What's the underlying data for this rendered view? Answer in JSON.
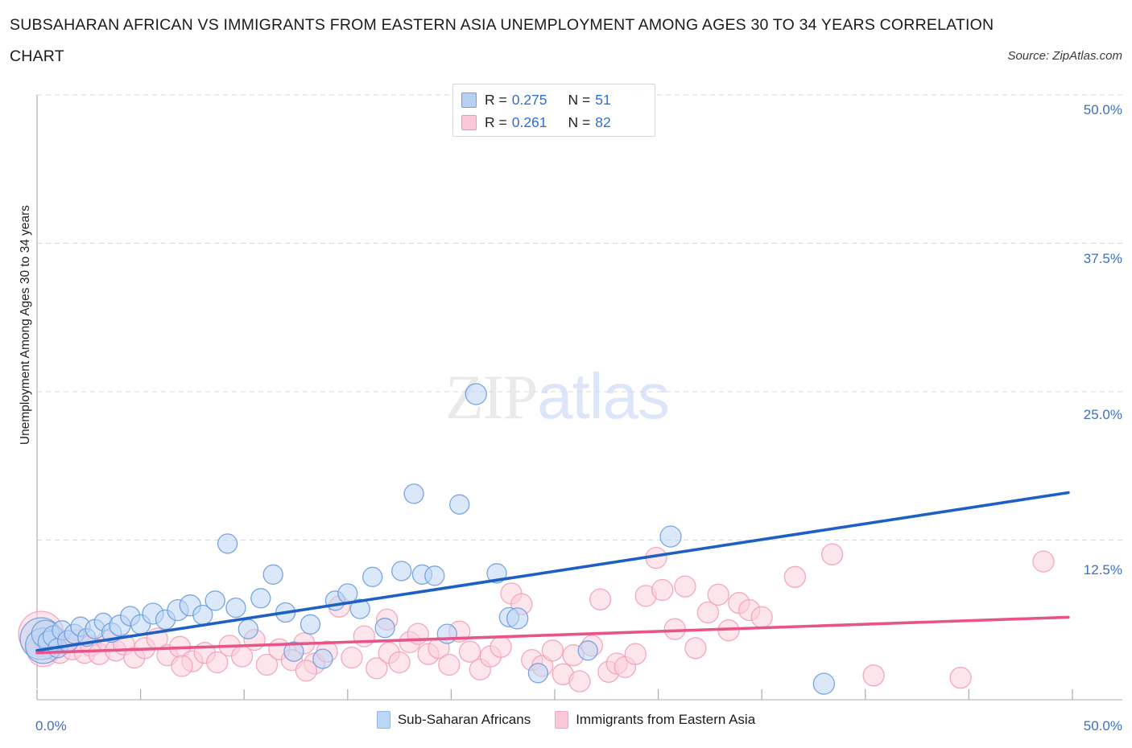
{
  "header": {
    "title_line1": "SUBSAHARAN AFRICAN VS IMMIGRANTS FROM EASTERN ASIA UNEMPLOYMENT AMONG AGES 30 TO 34 YEARS CORRELATION",
    "title_line2": "CHART",
    "source": "Source: ZipAtlas.com"
  },
  "watermark": {
    "part1": "ZIP",
    "part2": "atlas"
  },
  "stats": {
    "rows": [
      {
        "color": "blue",
        "r_label": "R =",
        "r_value": "0.275",
        "n_label": "N =",
        "n_value": "51"
      },
      {
        "color": "pink",
        "r_label": "R =",
        "r_value": "0.261",
        "n_label": "N =",
        "n_value": "82"
      }
    ]
  },
  "axis": {
    "y_ticks": [
      "50.0%",
      "37.5%",
      "25.0%",
      "12.5%"
    ],
    "x_min_label": "0.0%",
    "x_max_label": "50.0%",
    "y_title": "Unemployment Among Ages 30 to 34 years"
  },
  "colors": {
    "blue_fill": "#bdd6f4",
    "blue_stroke": "#6b9ddf",
    "blue_line": "#1d5fc4",
    "pink_fill": "#fcd0dd",
    "pink_stroke": "#f2a0b8",
    "pink_line": "#e8548a",
    "tick_text": "#3b6fc4"
  },
  "chart_data": {
    "type": "scatter",
    "title": "SUBSAHARAN AFRICAN VS IMMIGRANTS FROM EASTERN ASIA UNEMPLOYMENT AMONG AGES 30 TO 34 YEARS CORRELATION CHART",
    "xlabel": "",
    "ylabel": "Unemployment Among Ages 30 to 34 years",
    "xlim": [
      0.0,
      50.0
    ],
    "ylim": [
      0.0,
      53.0
    ],
    "xticks": [
      0.0,
      50.0
    ],
    "yticks": [
      12.5,
      25.0,
      37.5,
      50.0
    ],
    "grid": true,
    "legend_position": "bottom-center",
    "series": [
      {
        "name": "Sub-Saharan Africans",
        "color": "#bdd6f4",
        "R": 0.275,
        "N": 51,
        "trendline": {
          "x0": 0.0,
          "y0": 3.2,
          "x1": 49.8,
          "y1": 16.5,
          "color": "#1d5fc4"
        },
        "points": [
          [
            0.2,
            4.2,
            26
          ],
          [
            0.3,
            3.6,
            22
          ],
          [
            0.4,
            4.6,
            17
          ],
          [
            0.6,
            3.9,
            14
          ],
          [
            0.8,
            4.4,
            13
          ],
          [
            1.0,
            3.4,
            12
          ],
          [
            1.2,
            4.9,
            12
          ],
          [
            1.5,
            4.0,
            13
          ],
          [
            1.8,
            4.6,
            12
          ],
          [
            2.1,
            5.2,
            12
          ],
          [
            2.4,
            4.3,
            11
          ],
          [
            2.8,
            5.0,
            12
          ],
          [
            3.2,
            5.6,
            11
          ],
          [
            3.6,
            4.7,
            12
          ],
          [
            4.0,
            5.3,
            13
          ],
          [
            4.5,
            6.1,
            12
          ],
          [
            5.0,
            5.4,
            12
          ],
          [
            5.6,
            6.3,
            13
          ],
          [
            6.2,
            5.8,
            12
          ],
          [
            6.8,
            6.6,
            13
          ],
          [
            7.4,
            7.0,
            13
          ],
          [
            8.0,
            6.2,
            12
          ],
          [
            8.6,
            7.4,
            12
          ],
          [
            9.2,
            12.2,
            12
          ],
          [
            9.6,
            6.8,
            12
          ],
          [
            10.2,
            5.0,
            12
          ],
          [
            10.8,
            7.6,
            12
          ],
          [
            11.4,
            9.6,
            12
          ],
          [
            12.0,
            6.4,
            12
          ],
          [
            12.4,
            3.1,
            12
          ],
          [
            13.2,
            5.4,
            12
          ],
          [
            13.8,
            2.5,
            12
          ],
          [
            14.4,
            7.4,
            12
          ],
          [
            15.0,
            8.0,
            12
          ],
          [
            15.6,
            6.7,
            12
          ],
          [
            16.2,
            9.4,
            12
          ],
          [
            16.8,
            5.1,
            12
          ],
          [
            17.6,
            9.9,
            12
          ],
          [
            18.2,
            16.4,
            12
          ],
          [
            18.6,
            9.6,
            12
          ],
          [
            19.2,
            9.5,
            12
          ],
          [
            19.8,
            4.6,
            12
          ],
          [
            20.4,
            15.5,
            12
          ],
          [
            21.2,
            24.8,
            13
          ],
          [
            22.2,
            9.7,
            12
          ],
          [
            22.8,
            6.0,
            12
          ],
          [
            23.2,
            5.9,
            13
          ],
          [
            24.2,
            1.3,
            12
          ],
          [
            26.6,
            3.2,
            12
          ],
          [
            30.6,
            12.8,
            13
          ],
          [
            38.0,
            0.4,
            13
          ]
        ]
      },
      {
        "name": "Immigrants from Eastern Asia",
        "color": "#fcd0dd",
        "R": 0.261,
        "N": 82,
        "trendline": {
          "x0": 0.0,
          "y0": 3.0,
          "x1": 49.8,
          "y1": 6.0,
          "color": "#e8548a"
        },
        "points": [
          [
            0.2,
            4.6,
            28
          ],
          [
            0.3,
            3.2,
            20
          ],
          [
            0.5,
            4.0,
            16
          ],
          [
            0.7,
            3.4,
            14
          ],
          [
            0.9,
            4.2,
            13
          ],
          [
            1.1,
            3.0,
            13
          ],
          [
            1.4,
            3.8,
            13
          ],
          [
            1.7,
            3.3,
            13
          ],
          [
            2.0,
            4.1,
            13
          ],
          [
            2.3,
            3.0,
            13
          ],
          [
            2.6,
            3.6,
            13
          ],
          [
            3.0,
            2.9,
            13
          ],
          [
            3.4,
            4.0,
            13
          ],
          [
            3.8,
            3.2,
            13
          ],
          [
            4.2,
            3.7,
            13
          ],
          [
            4.7,
            2.6,
            13
          ],
          [
            5.2,
            3.4,
            13
          ],
          [
            5.8,
            4.2,
            13
          ],
          [
            6.3,
            2.8,
            13
          ],
          [
            6.9,
            3.5,
            13
          ],
          [
            7.5,
            2.3,
            13
          ],
          [
            8.1,
            3.0,
            13
          ],
          [
            8.7,
            2.2,
            13
          ],
          [
            9.3,
            3.6,
            13
          ],
          [
            9.9,
            2.7,
            13
          ],
          [
            10.5,
            4.1,
            13
          ],
          [
            11.1,
            2.0,
            13
          ],
          [
            11.7,
            3.3,
            13
          ],
          [
            12.3,
            2.4,
            13
          ],
          [
            12.9,
            3.8,
            13
          ],
          [
            13.4,
            2.1,
            13
          ],
          [
            14.0,
            3.1,
            13
          ],
          [
            14.6,
            6.9,
            13
          ],
          [
            15.2,
            2.6,
            13
          ],
          [
            15.8,
            4.4,
            13
          ],
          [
            16.4,
            1.7,
            13
          ],
          [
            17.0,
            3.0,
            13
          ],
          [
            17.5,
            2.2,
            13
          ],
          [
            18.0,
            3.9,
            13
          ],
          [
            18.4,
            4.6,
            13
          ],
          [
            18.9,
            2.9,
            13
          ],
          [
            19.4,
            3.4,
            13
          ],
          [
            19.9,
            2.0,
            13
          ],
          [
            20.4,
            4.8,
            13
          ],
          [
            20.9,
            3.1,
            13
          ],
          [
            21.4,
            1.6,
            13
          ],
          [
            21.9,
            2.7,
            13
          ],
          [
            22.4,
            3.5,
            13
          ],
          [
            22.9,
            8.0,
            13
          ],
          [
            23.4,
            7.1,
            13
          ],
          [
            23.9,
            2.4,
            13
          ],
          [
            24.4,
            1.9,
            13
          ],
          [
            24.9,
            3.2,
            13
          ],
          [
            25.4,
            1.2,
            13
          ],
          [
            25.9,
            2.8,
            13
          ],
          [
            26.2,
            0.6,
            13
          ],
          [
            26.8,
            3.6,
            13
          ],
          [
            27.2,
            7.5,
            13
          ],
          [
            27.6,
            1.4,
            13
          ],
          [
            28.0,
            2.1,
            13
          ],
          [
            28.4,
            1.8,
            13
          ],
          [
            28.9,
            2.9,
            13
          ],
          [
            29.4,
            7.8,
            13
          ],
          [
            29.9,
            11.0,
            13
          ],
          [
            30.2,
            8.3,
            13
          ],
          [
            30.8,
            5.0,
            13
          ],
          [
            31.3,
            8.6,
            13
          ],
          [
            31.8,
            3.4,
            13
          ],
          [
            32.4,
            6.4,
            13
          ],
          [
            32.9,
            7.9,
            13
          ],
          [
            33.4,
            4.9,
            13
          ],
          [
            33.9,
            7.2,
            13
          ],
          [
            34.4,
            6.6,
            13
          ],
          [
            35.0,
            6.0,
            13
          ],
          [
            36.6,
            9.4,
            13
          ],
          [
            38.4,
            11.3,
            13
          ],
          [
            40.4,
            1.1,
            13
          ],
          [
            44.6,
            0.9,
            13
          ],
          [
            48.6,
            10.7,
            13
          ],
          [
            13.0,
            1.5,
            13
          ],
          [
            16.9,
            5.8,
            13
          ],
          [
            7.0,
            1.9,
            13
          ]
        ]
      }
    ]
  }
}
